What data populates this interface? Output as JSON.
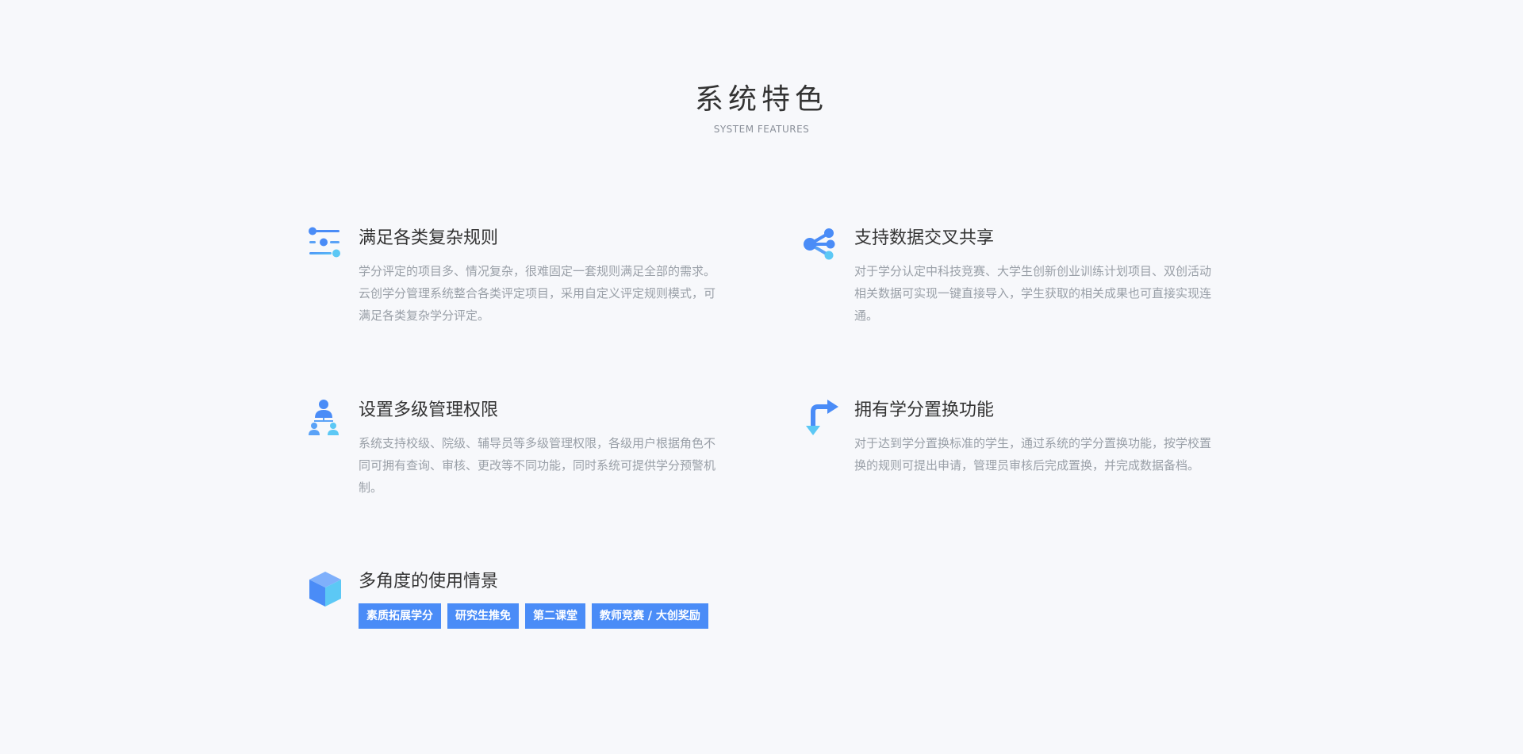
{
  "header": {
    "title": "系统特色",
    "subtitle": "SYSTEM FEATURES"
  },
  "features": [
    {
      "title": "满足各类复杂规则",
      "description": "学分评定的项目多、情况复杂，很难固定一套规则满足全部的需求。云创学分管理系统整合各类评定项目，采用自定义评定规则模式，可满足各类复杂学分评定。",
      "icon": "sliders-icon"
    },
    {
      "title": "支持数据交叉共享",
      "description": "对于学分认定中科技竞赛、大学生创新创业训练计划项目、双创活动相关数据可实现一键直接导入，学生获取的相关成果也可直接实现连通。",
      "icon": "share-icon"
    },
    {
      "title": "设置多级管理权限",
      "description": "系统支持校级、院级、辅导员等多级管理权限，各级用户根据角色不同可拥有查询、审核、更改等不同功能，同时系统可提供学分预警机制。",
      "icon": "hierarchy-users-icon"
    },
    {
      "title": "拥有学分置换功能",
      "description": "对于达到学分置换标准的学生，通过系统的学分置换功能，按学校置换的规则可提出申请，管理员审核后完成置换，并完成数据备档。",
      "icon": "exchange-arrows-icon"
    },
    {
      "title": "多角度的使用情景",
      "icon": "cube-icon",
      "tags": [
        "素质拓展学分",
        "研究生推免",
        "第二课堂",
        "教师竞赛 / 大创奖励"
      ]
    }
  ],
  "colors": {
    "accent": "#4a8cf7",
    "background": "#f7f8fb",
    "title_text": "#333333",
    "desc_text": "#9aa0a8"
  }
}
